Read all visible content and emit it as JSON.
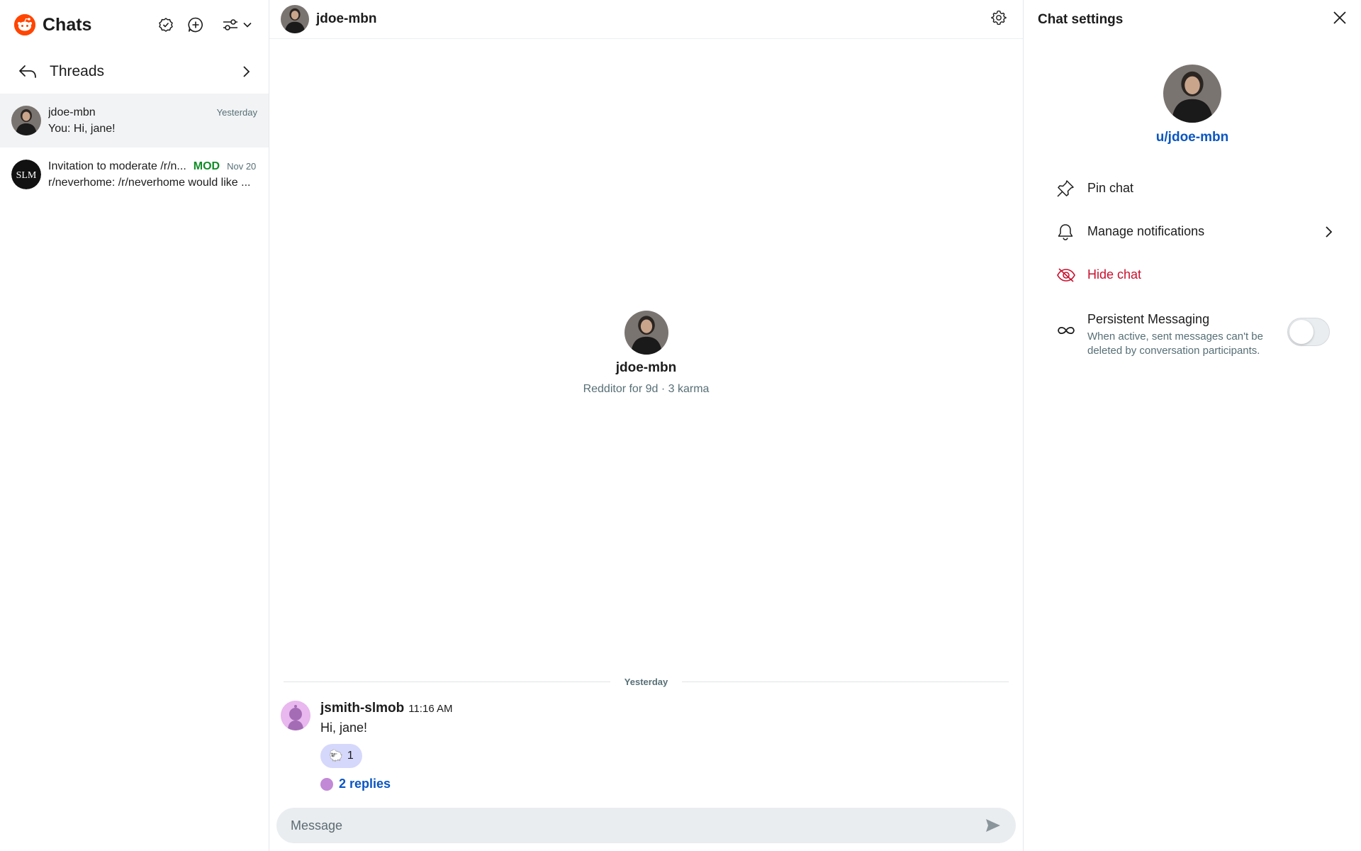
{
  "sidebar": {
    "title": "Chats",
    "threads_label": "Threads",
    "chats": [
      {
        "name": "jdoe-mbn",
        "time": "Yesterday",
        "preview": "You: Hi, jane!",
        "badge": ""
      },
      {
        "name": "Invitation to moderate /r/n...",
        "time": "Nov 20",
        "preview": "r/neverhome: /r/neverhome would like ...",
        "badge": "MOD",
        "avatar_text": "SLM"
      }
    ]
  },
  "main": {
    "header_name": "jdoe-mbn",
    "profile": {
      "name": "jdoe-mbn",
      "meta": "Redditor for 9d · 3 karma"
    },
    "divider": "Yesterday",
    "message": {
      "user": "jsmith-slmob",
      "time": "11:16 AM",
      "text": "Hi, jane!",
      "reaction_emoji": "🐑",
      "reaction_count": "1",
      "replies": "2 replies"
    },
    "composer_placeholder": "Message"
  },
  "settings": {
    "title": "Chat settings",
    "username": "u/jdoe-mbn",
    "pin_chat": "Pin chat",
    "manage_notifications": "Manage notifications",
    "hide_chat": "Hide chat",
    "persistent_title": "Persistent Messaging",
    "persistent_desc": "When active, sent messages can't be deleted by conversation participants.",
    "persistent_enabled": false
  },
  "colors": {
    "brand": "#ff4500",
    "link": "#0a56c2",
    "danger": "#c8102e",
    "mod": "#108c26",
    "reaction_bg": "#d5d8fb"
  }
}
